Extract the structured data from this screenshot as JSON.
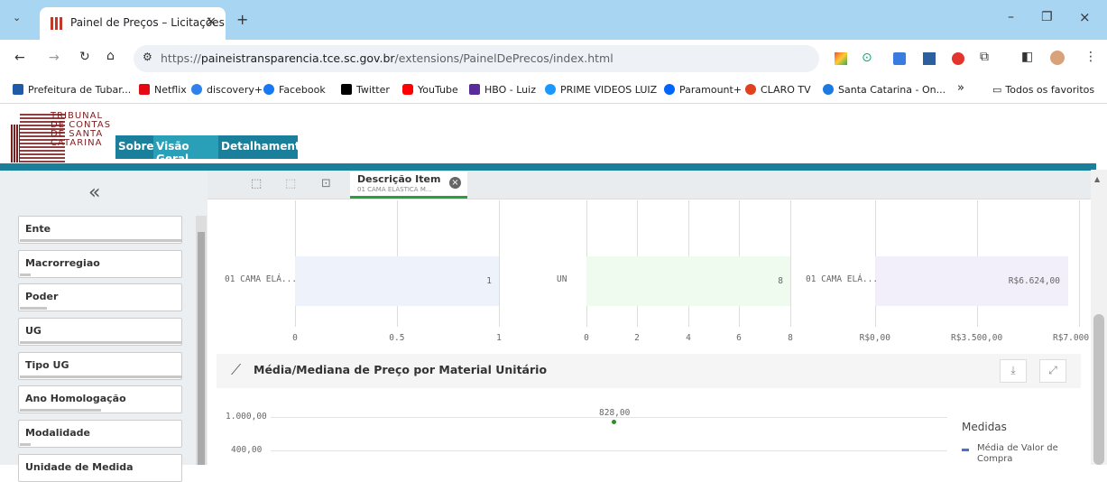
{
  "browser": {
    "tab_title": "Painel de Preços – Licitações",
    "url_prefix": "https://",
    "url_host": "paineistransparencia.tce.sc.gov.br",
    "url_path": "/extensions/PainelDePrecos/index.html",
    "bookmarks": [
      "Prefeitura de Tubar...",
      "Netflix",
      "discovery+",
      "Facebook",
      "Twitter",
      "YouTube",
      "HBO - Luiz",
      "PRIME VIDEOS LUIZ",
      "Paramount+",
      "CLARO TV",
      "Santa Catarina - On..."
    ],
    "bookmarks_more": "»",
    "all_bookmarks": "Todos os favoritos"
  },
  "logo": {
    "lines": [
      "TRIBUNAL",
      "DE CONTAS",
      "DE SANTA",
      "CATARINA"
    ]
  },
  "nav": {
    "tabs": [
      "Sobre",
      "Visão Geral",
      "Detalhamento"
    ],
    "colors": [
      "#1a7f9a",
      "#2a9fb8",
      "#1a7f9a"
    ]
  },
  "sidebar": {
    "collapse": "«",
    "filters": [
      "Ente",
      "Macrorregiao",
      "Poder",
      "UG",
      "Tipo UG",
      "Ano Homologação",
      "Modalidade",
      "Unidade de Medida"
    ]
  },
  "selection": {
    "title": "Descrição Item",
    "value": "01 CAMA ELÁSTICA M..."
  },
  "charts": {
    "quantity": {
      "label": "01 CAMA ELÁ...",
      "value": "1",
      "ticks": [
        "0",
        "0.5",
        "1"
      ],
      "fraction": 1.0,
      "color": "#eef2fb"
    },
    "unit": {
      "label": "UN",
      "value": "8",
      "ticks": [
        "0",
        "2",
        "4",
        "6",
        "8"
      ],
      "fraction": 1.0,
      "color": "#eefbee"
    },
    "price": {
      "label": "01 CAMA ELÁ...",
      "value": "R$6.624,00",
      "ticks": [
        "R$0,00",
        "R$3.500,00",
        "R$7.000,00"
      ],
      "fraction": 0.946,
      "color": "#f2effb"
    }
  },
  "line_chart": {
    "title": "Média/Mediana de Preço por Material Unitário",
    "yticks": [
      "1.000,00",
      "400,00"
    ],
    "point_label": "828,00",
    "legend_title": "Medidas",
    "legend_item": "Média de Valor de Compra",
    "point_color": "#2e8b2e"
  }
}
